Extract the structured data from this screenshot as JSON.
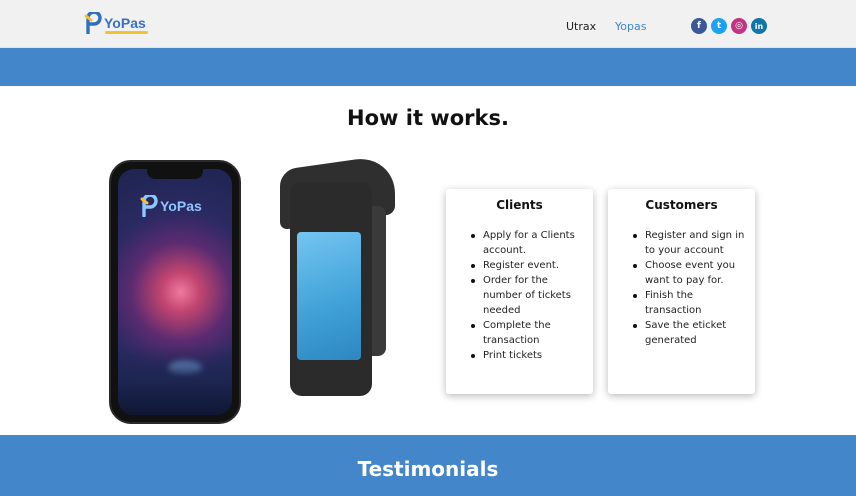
{
  "header": {
    "logo_text": "YoPas",
    "nav": [
      {
        "label": "Utrax",
        "color": "#222222"
      },
      {
        "label": "Yopas",
        "color": "#3f86cc"
      }
    ],
    "socials": [
      {
        "name": "facebook-icon",
        "glyph": "f",
        "color": "#3b5998"
      },
      {
        "name": "twitter-icon",
        "glyph": "t",
        "color": "#1da1f2"
      },
      {
        "name": "instagram-icon",
        "glyph": "◎",
        "color": "#c13584"
      },
      {
        "name": "linkedin-icon",
        "glyph": "in",
        "color": "#0e76a8"
      }
    ]
  },
  "band_color": "#4386c9",
  "how": {
    "title": "How it works.",
    "phone_logo": "YoPas"
  },
  "cards": {
    "clients": {
      "title": "Clients",
      "items": [
        "Apply for a Clients account.",
        "Register event.",
        "Order for the number of tickets needed",
        "Complete the transaction",
        "Print tickets"
      ]
    },
    "customers": {
      "title": "Customers",
      "items": [
        "Register and sign in to your account",
        "Choose event you want to pay for.",
        "Finish the transaction",
        "Save the eticket generated"
      ]
    }
  },
  "testimonials": {
    "title": "Testimonials"
  }
}
